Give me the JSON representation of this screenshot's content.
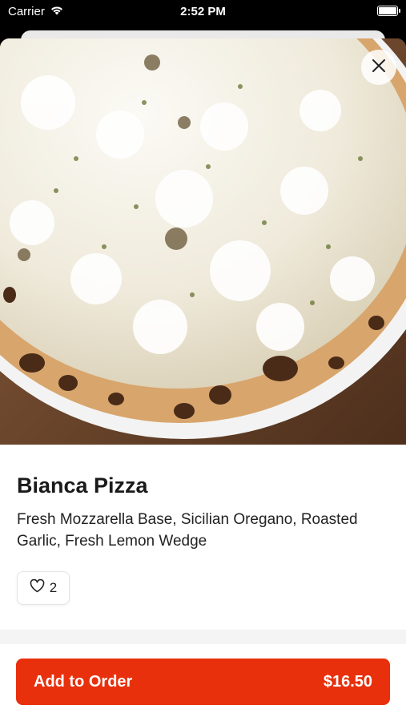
{
  "status_bar": {
    "carrier": "Carrier",
    "time": "2:52 PM"
  },
  "item": {
    "name": "Bianca Pizza",
    "description": "Fresh Mozzarella Base, Sicilian Oregano, Roasted Garlic, Fresh Lemon Wedge",
    "likes": "2"
  },
  "cta": {
    "label": "Add to Order",
    "price": "$16.50"
  },
  "colors": {
    "accent": "#e8300c"
  },
  "icons": {
    "close": "close-icon",
    "like": "heart-icon",
    "wifi": "wifi-icon",
    "battery": "battery-icon"
  }
}
